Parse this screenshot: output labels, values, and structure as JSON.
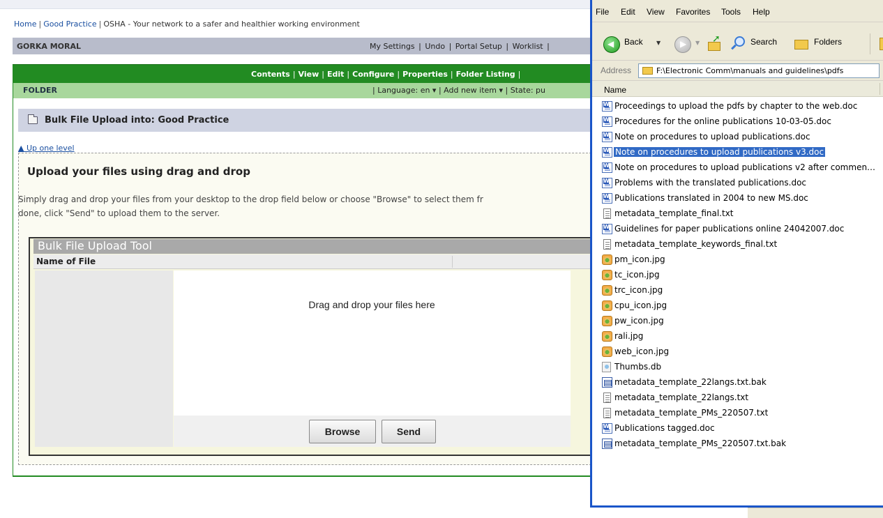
{
  "breadcrumb": {
    "items": [
      "Home",
      "Good Practice",
      "OSHA - Your network to a safer and healthier working environment"
    ]
  },
  "userbar": {
    "username": "GORKA MORAL",
    "links": [
      "My Settings",
      "Undo",
      "Portal Setup",
      "Worklist"
    ]
  },
  "tabs": [
    "Contents",
    "View",
    "Edit",
    "Configure",
    "Properties",
    "Folder Listing"
  ],
  "folderbar": {
    "label": "FOLDER",
    "actions": "| Language: en ▾ | Add new item ▾ | State: pu"
  },
  "page": {
    "title": "Bulk File Upload into: Good Practice",
    "up_one_level": "▲ Up one level",
    "heading": "Upload your files using drag and drop",
    "instructions_line1": "Simply drag and drop your files from your desktop to the drop field below or choose \"Browse\" to select them fr",
    "instructions_line2": "done, click \"Send\" to upload them to the server."
  },
  "tool": {
    "title": "Bulk File Upload Tool",
    "column_name": "Name of File",
    "drop_text": "Drag and drop your files here",
    "browse_label": "Browse",
    "send_label": "Send"
  },
  "explorer": {
    "menu": [
      "File",
      "Edit",
      "View",
      "Favorites",
      "Tools",
      "Help"
    ],
    "back_label": "Back",
    "search_label": "Search",
    "folders_label": "Folders",
    "address_label": "Address",
    "address_value": "F:\\Electronic Comm\\manuals and guidelines\\pdfs",
    "column_name": "Name",
    "selected_index": 3,
    "files": [
      {
        "name": "Proceedings to upload the pdfs by chapter to the web.doc",
        "icon": "doc"
      },
      {
        "name": "Procedures for the online publications 10-03-05.doc",
        "icon": "doc"
      },
      {
        "name": "Note on procedures to upload publications.doc",
        "icon": "doc"
      },
      {
        "name": "Note on procedures to upload publications v3.doc",
        "icon": "doc"
      },
      {
        "name": "Note on procedures to upload publications v2 after commen…",
        "icon": "doc"
      },
      {
        "name": "Problems with the translated publications.doc",
        "icon": "doc"
      },
      {
        "name": "Publications translated in 2004 to new MS.doc",
        "icon": "doc"
      },
      {
        "name": "metadata_template_final.txt",
        "icon": "txt"
      },
      {
        "name": "Guidelines for paper publications online 24042007.doc",
        "icon": "doc"
      },
      {
        "name": "metadata_template_keywords_final.txt",
        "icon": "txt"
      },
      {
        "name": "pm_icon.jpg",
        "icon": "jpg"
      },
      {
        "name": "tc_icon.jpg",
        "icon": "jpg"
      },
      {
        "name": "trc_icon.jpg",
        "icon": "jpg"
      },
      {
        "name": "cpu_icon.jpg",
        "icon": "jpg"
      },
      {
        "name": "pw_icon.jpg",
        "icon": "jpg"
      },
      {
        "name": "rali.jpg",
        "icon": "jpg"
      },
      {
        "name": "web_icon.jpg",
        "icon": "jpg"
      },
      {
        "name": "Thumbs.db",
        "icon": "db"
      },
      {
        "name": "metadata_template_22langs.txt.bak",
        "icon": "bak"
      },
      {
        "name": "metadata_template_22langs.txt",
        "icon": "txt"
      },
      {
        "name": "metadata_template_PMs_220507.txt",
        "icon": "txt"
      },
      {
        "name": "Publications tagged.doc",
        "icon": "doc"
      },
      {
        "name": "metadata_template_PMs_220507.txt.bak",
        "icon": "bak"
      }
    ]
  },
  "colors": {
    "plone_green": "#228b22",
    "folder_green": "#a8d79c",
    "userbar_grey": "#b8bccb",
    "xp_blue_border": "#1a55c9",
    "selection_blue": "#316ac5"
  }
}
